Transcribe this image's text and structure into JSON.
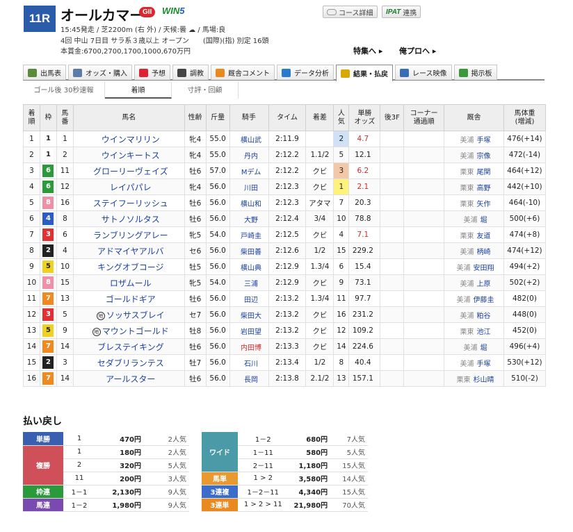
{
  "header": {
    "race_number": "11R",
    "race_name": "オールカマー",
    "grade": "GII",
    "win5_prefix": "WIN",
    "win5_suffix": "5",
    "line1": "15:45発走 / 芝2200m (右 外) / 天候:曇 ☁ / 馬場:良",
    "line2": "4回 中山 7日目 サラ系３歳以上 オープン　　(国際)(指) 別定 16頭",
    "line3": "本賞金:6700,2700,1700,1000,670万円",
    "course_button": "コース詳細",
    "ipat_logo": "IPAT",
    "ipat_button": "連携",
    "feature_link": "特集へ ▸",
    "orepro_link": "俺プロへ ▸"
  },
  "tabs": [
    {
      "label": "出馬表",
      "color": "#5a8a3a"
    },
    {
      "label": "オッズ・購入",
      "color": "#5b7ca8"
    },
    {
      "label": "予想",
      "color": "#d23"
    },
    {
      "label": "調教",
      "color": "#444"
    },
    {
      "label": "厩舎コメント",
      "color": "#e88a20"
    },
    {
      "label": "データ分析",
      "color": "#2a7ad0"
    },
    {
      "label": "結果・払戻",
      "color": "#d9a800"
    },
    {
      "label": "レース映像",
      "color": "#3a6cb8"
    },
    {
      "label": "掲示板",
      "color": "#3a9a3a"
    }
  ],
  "subtabs": [
    "ゴール後 30秒速報",
    "着順",
    "寸評・回顧"
  ],
  "columns": [
    "着\n順",
    "枠",
    "馬\n番",
    "馬名",
    "性齢",
    "斤量",
    "騎手",
    "タイム",
    "着差",
    "人\n気",
    "単勝\nオッズ",
    "後3F",
    "コーナー\n通過順",
    "厩舎",
    "馬体重\n(増減)"
  ],
  "waku_colors": {
    "1": {
      "bg": "#ffffff",
      "fg": "#222222"
    },
    "2": {
      "bg": "#222222",
      "fg": "#ffffff"
    },
    "3": {
      "bg": "#e03030",
      "fg": "#ffffff"
    },
    "4": {
      "bg": "#2a5cc8",
      "fg": "#ffffff"
    },
    "5": {
      "bg": "#f0d020",
      "fg": "#222222"
    },
    "6": {
      "bg": "#2a9a3a",
      "fg": "#ffffff"
    },
    "7": {
      "bg": "#f08a20",
      "fg": "#ffffff"
    },
    "8": {
      "bg": "#f090a8",
      "fg": "#ffffff"
    }
  },
  "rows": [
    {
      "rank": "1",
      "waku": "1",
      "num": "1",
      "name": "ウインマリリン",
      "mark": "",
      "sexage": "牝4",
      "weight": "55.0",
      "jockey": "横山武",
      "jockey_red": false,
      "time": "2:11.9",
      "margin": "",
      "pop": "2",
      "odds": "4.7",
      "aff": "美浦",
      "trainer": "手塚",
      "body": "476(+14)"
    },
    {
      "rank": "2",
      "waku": "1",
      "num": "2",
      "name": "ウインキートス",
      "mark": "",
      "sexage": "牝4",
      "weight": "55.0",
      "jockey": "丹内",
      "jockey_red": false,
      "time": "2:12.2",
      "margin": "1.1/2",
      "pop": "5",
      "odds": "12.1",
      "aff": "美浦",
      "trainer": "宗像",
      "body": "472(-14)"
    },
    {
      "rank": "3",
      "waku": "6",
      "num": "11",
      "name": "グローリーヴェイズ",
      "mark": "",
      "sexage": "牡6",
      "weight": "57.0",
      "jockey": "Mデム",
      "jockey_red": false,
      "time": "2:12.2",
      "margin": "クビ",
      "pop": "3",
      "odds": "6.2",
      "aff": "栗東",
      "trainer": "尾関",
      "body": "464(+12)"
    },
    {
      "rank": "4",
      "waku": "6",
      "num": "12",
      "name": "レイパパレ",
      "mark": "",
      "sexage": "牝4",
      "weight": "56.0",
      "jockey": "川田",
      "jockey_red": false,
      "time": "2:12.3",
      "margin": "クビ",
      "pop": "1",
      "odds": "2.1",
      "aff": "栗東",
      "trainer": "高野",
      "body": "442(+10)"
    },
    {
      "rank": "5",
      "waku": "8",
      "num": "16",
      "name": "ステイフーリッシュ",
      "mark": "",
      "sexage": "牡6",
      "weight": "56.0",
      "jockey": "横山和",
      "jockey_red": false,
      "time": "2:12.3",
      "margin": "アタマ",
      "pop": "7",
      "odds": "20.3",
      "aff": "栗東",
      "trainer": "矢作",
      "body": "464(-10)"
    },
    {
      "rank": "6",
      "waku": "4",
      "num": "8",
      "name": "サトノソルタス",
      "mark": "",
      "sexage": "牡6",
      "weight": "56.0",
      "jockey": "大野",
      "jockey_red": false,
      "time": "2:12.4",
      "margin": "3/4",
      "pop": "10",
      "odds": "78.8",
      "aff": "美浦",
      "trainer": "堀",
      "body": "500(+6)"
    },
    {
      "rank": "7",
      "waku": "3",
      "num": "6",
      "name": "ランブリングアレー",
      "mark": "",
      "sexage": "牝5",
      "weight": "54.0",
      "jockey": "戸崎圭",
      "jockey_red": false,
      "time": "2:12.5",
      "margin": "クビ",
      "pop": "4",
      "odds": "7.1",
      "aff": "栗東",
      "trainer": "友道",
      "body": "474(+8)"
    },
    {
      "rank": "8",
      "waku": "2",
      "num": "4",
      "name": "アドマイヤアルバ",
      "mark": "",
      "sexage": "セ6",
      "weight": "56.0",
      "jockey": "柴田善",
      "jockey_red": false,
      "time": "2:12.6",
      "margin": "1/2",
      "pop": "15",
      "odds": "229.2",
      "aff": "美浦",
      "trainer": "柄崎",
      "body": "474(+12)"
    },
    {
      "rank": "9",
      "waku": "5",
      "num": "10",
      "name": "キングオブコージ",
      "mark": "",
      "sexage": "牡5",
      "weight": "56.0",
      "jockey": "横山典",
      "jockey_red": false,
      "time": "2:12.9",
      "margin": "1.3/4",
      "pop": "6",
      "odds": "15.4",
      "aff": "美浦",
      "trainer": "安田翔",
      "body": "494(+2)"
    },
    {
      "rank": "10",
      "waku": "8",
      "num": "15",
      "name": "ロザムール",
      "mark": "",
      "sexage": "牝5",
      "weight": "54.0",
      "jockey": "三浦",
      "jockey_red": false,
      "time": "2:12.9",
      "margin": "クビ",
      "pop": "9",
      "odds": "73.1",
      "aff": "美浦",
      "trainer": "上原",
      "body": "502(+2)"
    },
    {
      "rank": "11",
      "waku": "7",
      "num": "13",
      "name": "ゴールドギア",
      "mark": "",
      "sexage": "牡6",
      "weight": "56.0",
      "jockey": "田辺",
      "jockey_red": false,
      "time": "2:13.2",
      "margin": "1.3/4",
      "pop": "11",
      "odds": "97.7",
      "aff": "美浦",
      "trainer": "伊藤圭",
      "body": "482(0)"
    },
    {
      "rank": "12",
      "waku": "3",
      "num": "5",
      "name": "ソッサスブレイ",
      "mark": "地",
      "sexage": "セ7",
      "weight": "56.0",
      "jockey": "柴田大",
      "jockey_red": false,
      "time": "2:13.2",
      "margin": "クビ",
      "pop": "16",
      "odds": "231.2",
      "aff": "美浦",
      "trainer": "粕谷",
      "body": "448(0)"
    },
    {
      "rank": "13",
      "waku": "5",
      "num": "9",
      "name": "マウントゴールド",
      "mark": "地",
      "sexage": "牡8",
      "weight": "56.0",
      "jockey": "岩田望",
      "jockey_red": false,
      "time": "2:13.2",
      "margin": "クビ",
      "pop": "12",
      "odds": "109.2",
      "aff": "栗東",
      "trainer": "池江",
      "body": "452(0)"
    },
    {
      "rank": "14",
      "waku": "7",
      "num": "14",
      "name": "ブレステイキング",
      "mark": "",
      "sexage": "牡6",
      "weight": "56.0",
      "jockey": "内田博",
      "jockey_red": true,
      "time": "2:13.3",
      "margin": "クビ",
      "pop": "14",
      "odds": "224.6",
      "aff": "美浦",
      "trainer": "堀",
      "body": "496(+4)"
    },
    {
      "rank": "15",
      "waku": "2",
      "num": "3",
      "name": "セダブリランテス",
      "mark": "",
      "sexage": "牡7",
      "weight": "56.0",
      "jockey": "石川",
      "jockey_red": false,
      "time": "2:13.4",
      "margin": "1/2",
      "pop": "8",
      "odds": "40.4",
      "aff": "美浦",
      "trainer": "手塚",
      "body": "530(+12)"
    },
    {
      "rank": "16",
      "waku": "7",
      "num": "14",
      "name": "アールスター",
      "mark": "",
      "sexage": "牡6",
      "weight": "56.0",
      "jockey": "長岡",
      "jockey_red": false,
      "time": "2:13.8",
      "margin": "2.1/2",
      "pop": "13",
      "odds": "157.1",
      "aff": "栗東",
      "trainer": "杉山晴",
      "body": "510(-2)"
    }
  ],
  "payout": {
    "title": "払い戻し",
    "left": [
      {
        "label": "単勝",
        "color": "#3a5fb0",
        "lines": [
          {
            "comb": "1",
            "yen": "470円",
            "pop": "2人気"
          }
        ]
      },
      {
        "label": "複勝",
        "color": "#d0505a",
        "lines": [
          {
            "comb": "1",
            "yen": "180円",
            "pop": "2人気"
          },
          {
            "comb": "2",
            "yen": "320円",
            "pop": "5人気"
          },
          {
            "comb": "11",
            "yen": "200円",
            "pop": "3人気"
          }
        ]
      },
      {
        "label": "枠連",
        "color": "#2a9a3a",
        "lines": [
          {
            "comb": "1－1",
            "yen": "2,130円",
            "pop": "9人気"
          }
        ]
      },
      {
        "label": "馬連",
        "color": "#7a4ab0",
        "lines": [
          {
            "comb": "1－2",
            "yen": "1,980円",
            "pop": "9人気"
          }
        ]
      }
    ],
    "right": [
      {
        "label": "ワイド",
        "color": "#4a9aa8",
        "lines": [
          {
            "comb": "1－2",
            "yen": "680円",
            "pop": "7人気"
          },
          {
            "comb": "1－11",
            "yen": "580円",
            "pop": "5人気"
          },
          {
            "comb": "2－11",
            "yen": "1,180円",
            "pop": "15人気"
          }
        ]
      },
      {
        "label": "馬単",
        "color": "#e89a30",
        "lines": [
          {
            "comb": "1 > 2",
            "yen": "3,580円",
            "pop": "14人気"
          }
        ]
      },
      {
        "label": "3連複",
        "color": "#3a6cc8",
        "lines": [
          {
            "comb": "1－2－11",
            "yen": "4,340円",
            "pop": "15人気"
          }
        ]
      },
      {
        "label": "3連単",
        "color": "#e88a20",
        "lines": [
          {
            "comb": "1 > 2 > 11",
            "yen": "21,980円",
            "pop": "70人気"
          }
        ]
      }
    ]
  }
}
